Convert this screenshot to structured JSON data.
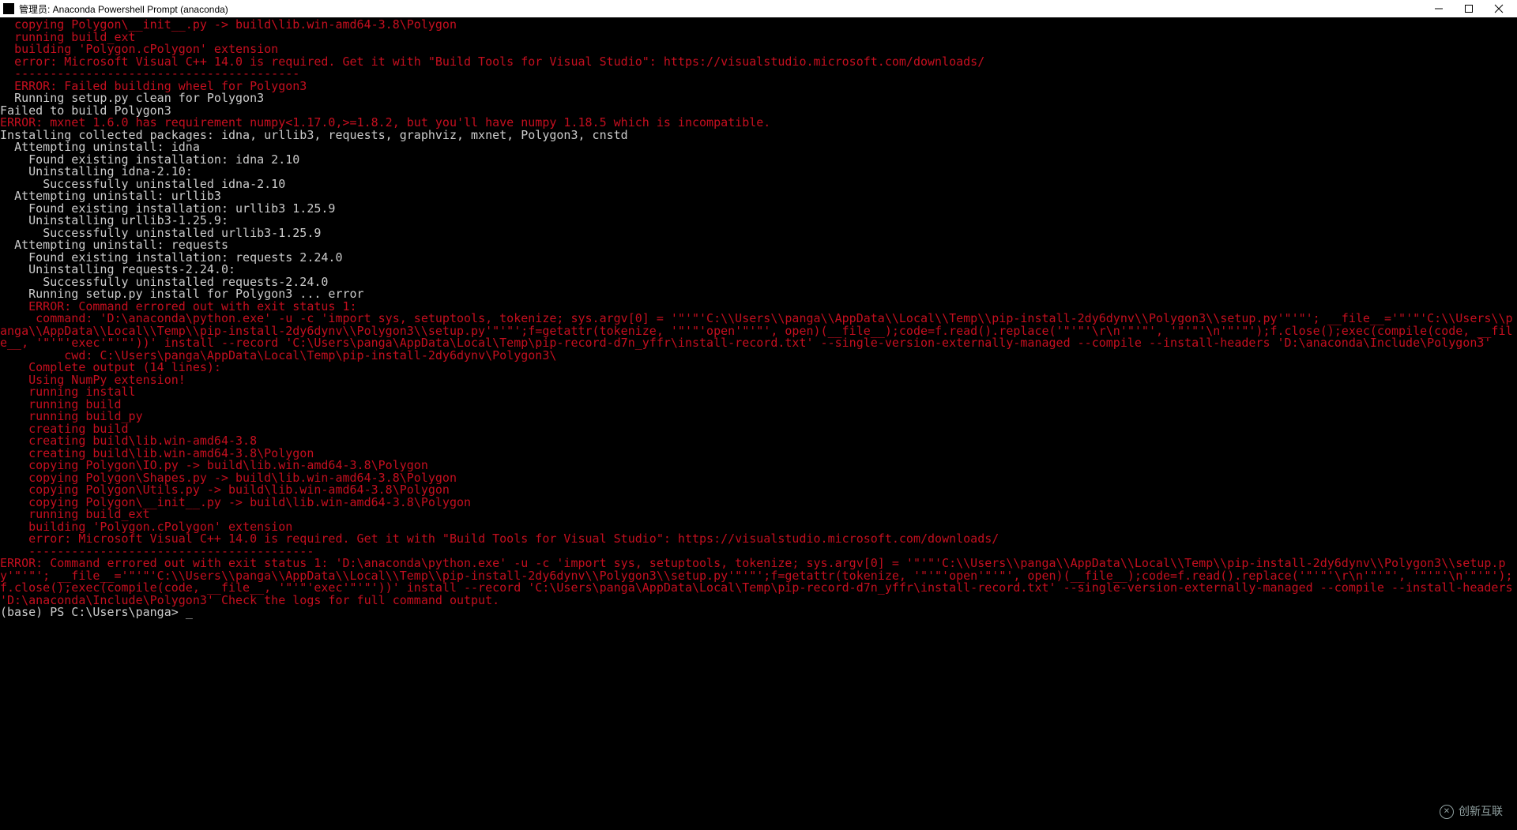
{
  "window": {
    "title": "管理员: Anaconda Powershell Prompt (anaconda)"
  },
  "terminal": {
    "lines": [
      {
        "cls": "c-red",
        "ind": 2,
        "t": "copying Polygon\\__init__.py -> build\\lib.win-amd64-3.8\\Polygon"
      },
      {
        "cls": "c-red",
        "ind": 2,
        "t": "running build_ext"
      },
      {
        "cls": "c-red",
        "ind": 2,
        "t": "building 'Polygon.cPolygon' extension"
      },
      {
        "cls": "c-red",
        "ind": 2,
        "t": "error: Microsoft Visual C++ 14.0 is required. Get it with \"Build Tools for Visual Studio\": https://visualstudio.microsoft.com/downloads/"
      },
      {
        "cls": "c-red",
        "ind": 2,
        "t": "----------------------------------------"
      },
      {
        "cls": "c-red",
        "ind": 2,
        "t": "ERROR: Failed building wheel for Polygon3"
      },
      {
        "cls": "c-white",
        "ind": 2,
        "t": "Running setup.py clean for Polygon3"
      },
      {
        "cls": "c-white",
        "ind": 0,
        "t": "Failed to build Polygon3"
      },
      {
        "cls": "c-red",
        "ind": 0,
        "t": "ERROR: mxnet 1.6.0 has requirement numpy<1.17.0,>=1.8.2, but you'll have numpy 1.18.5 which is incompatible."
      },
      {
        "cls": "c-white",
        "ind": 0,
        "t": "Installing collected packages: idna, urllib3, requests, graphviz, mxnet, Polygon3, cnstd"
      },
      {
        "cls": "c-white",
        "ind": 2,
        "t": "Attempting uninstall: idna"
      },
      {
        "cls": "c-white",
        "ind": 4,
        "t": "Found existing installation: idna 2.10"
      },
      {
        "cls": "c-white",
        "ind": 4,
        "t": "Uninstalling idna-2.10:"
      },
      {
        "cls": "c-white",
        "ind": 6,
        "t": "Successfully uninstalled idna-2.10"
      },
      {
        "cls": "c-white",
        "ind": 2,
        "t": "Attempting uninstall: urllib3"
      },
      {
        "cls": "c-white",
        "ind": 4,
        "t": "Found existing installation: urllib3 1.25.9"
      },
      {
        "cls": "c-white",
        "ind": 4,
        "t": "Uninstalling urllib3-1.25.9:"
      },
      {
        "cls": "c-white",
        "ind": 6,
        "t": "Successfully uninstalled urllib3-1.25.9"
      },
      {
        "cls": "c-white",
        "ind": 2,
        "t": "Attempting uninstall: requests"
      },
      {
        "cls": "c-white",
        "ind": 4,
        "t": "Found existing installation: requests 2.24.0"
      },
      {
        "cls": "c-white",
        "ind": 4,
        "t": "Uninstalling requests-2.24.0:"
      },
      {
        "cls": "c-white",
        "ind": 6,
        "t": "Successfully uninstalled requests-2.24.0"
      },
      {
        "cls": "c-white",
        "ind": 4,
        "t": "Running setup.py install for Polygon3 ... error"
      },
      {
        "cls": "c-red",
        "ind": 4,
        "t": "ERROR: Command errored out with exit status 1:"
      },
      {
        "cls": "c-red",
        "ind": 0,
        "t": "     command: 'D:\\anaconda\\python.exe' -u -c 'import sys, setuptools, tokenize; sys.argv[0] = '\"'\"'C:\\\\Users\\\\panga\\\\AppData\\\\Local\\\\Temp\\\\pip-install-2dy6dynv\\\\Polygon3\\\\setup.py'\"'\"'; __file__='\"'\"'C:\\\\Users\\\\panga\\\\AppData\\\\Local\\\\Temp\\\\pip-install-2dy6dynv\\\\Polygon3\\\\setup.py'\"'\"';f=getattr(tokenize, '\"'\"'open'\"'\"', open)(__file__);code=f.read().replace('\"'\"'\\r\\n'\"'\"', '\"'\"'\\n'\"'\"');f.close();exec(compile(code, __file__, '\"'\"'exec'\"'\"'))' install --record 'C:\\Users\\panga\\AppData\\Local\\Temp\\pip-record-d7n_yffr\\install-record.txt' --single-version-externally-managed --compile --install-headers 'D:\\anaconda\\Include\\Polygon3'"
      },
      {
        "cls": "c-red",
        "ind": 9,
        "t": "cwd: C:\\Users\\panga\\AppData\\Local\\Temp\\pip-install-2dy6dynv\\Polygon3\\"
      },
      {
        "cls": "c-red",
        "ind": 4,
        "t": "Complete output (14 lines):"
      },
      {
        "cls": "c-red",
        "ind": 4,
        "t": "Using NumPy extension!"
      },
      {
        "cls": "c-red",
        "ind": 4,
        "t": "running install"
      },
      {
        "cls": "c-red",
        "ind": 4,
        "t": "running build"
      },
      {
        "cls": "c-red",
        "ind": 4,
        "t": "running build_py"
      },
      {
        "cls": "c-red",
        "ind": 4,
        "t": "creating build"
      },
      {
        "cls": "c-red",
        "ind": 4,
        "t": "creating build\\lib.win-amd64-3.8"
      },
      {
        "cls": "c-red",
        "ind": 4,
        "t": "creating build\\lib.win-amd64-3.8\\Polygon"
      },
      {
        "cls": "c-red",
        "ind": 4,
        "t": "copying Polygon\\IO.py -> build\\lib.win-amd64-3.8\\Polygon"
      },
      {
        "cls": "c-red",
        "ind": 4,
        "t": "copying Polygon\\Shapes.py -> build\\lib.win-amd64-3.8\\Polygon"
      },
      {
        "cls": "c-red",
        "ind": 4,
        "t": "copying Polygon\\Utils.py -> build\\lib.win-amd64-3.8\\Polygon"
      },
      {
        "cls": "c-red",
        "ind": 4,
        "t": "copying Polygon\\__init__.py -> build\\lib.win-amd64-3.8\\Polygon"
      },
      {
        "cls": "c-red",
        "ind": 4,
        "t": "running build_ext"
      },
      {
        "cls": "c-red",
        "ind": 4,
        "t": "building 'Polygon.cPolygon' extension"
      },
      {
        "cls": "c-red",
        "ind": 4,
        "t": "error: Microsoft Visual C++ 14.0 is required. Get it with \"Build Tools for Visual Studio\": https://visualstudio.microsoft.com/downloads/"
      },
      {
        "cls": "c-red",
        "ind": 4,
        "t": "----------------------------------------"
      },
      {
        "cls": "c-red",
        "ind": 0,
        "t": "ERROR: Command errored out with exit status 1: 'D:\\anaconda\\python.exe' -u -c 'import sys, setuptools, tokenize; sys.argv[0] = '\"'\"'C:\\\\Users\\\\panga\\\\AppData\\\\Local\\\\Temp\\\\pip-install-2dy6dynv\\\\Polygon3\\\\setup.py'\"'\"'; __file__='\"'\"'C:\\\\Users\\\\panga\\\\AppData\\\\Local\\\\Temp\\\\pip-install-2dy6dynv\\\\Polygon3\\\\setup.py'\"'\"';f=getattr(tokenize, '\"'\"'open'\"'\"', open)(__file__);code=f.read().replace('\"'\"'\\r\\n'\"'\"', '\"'\"'\\n'\"'\"');f.close();exec(compile(code, __file__, '\"'\"'exec'\"'\"'))' install --record 'C:\\Users\\panga\\AppData\\Local\\Temp\\pip-record-d7n_yffr\\install-record.txt' --single-version-externally-managed --compile --install-headers 'D:\\anaconda\\Include\\Polygon3' Check the logs for full command output."
      }
    ],
    "prompt": "(base) PS C:\\Users\\panga> ",
    "cursor": "_"
  },
  "watermark": {
    "text": "创新互联"
  }
}
